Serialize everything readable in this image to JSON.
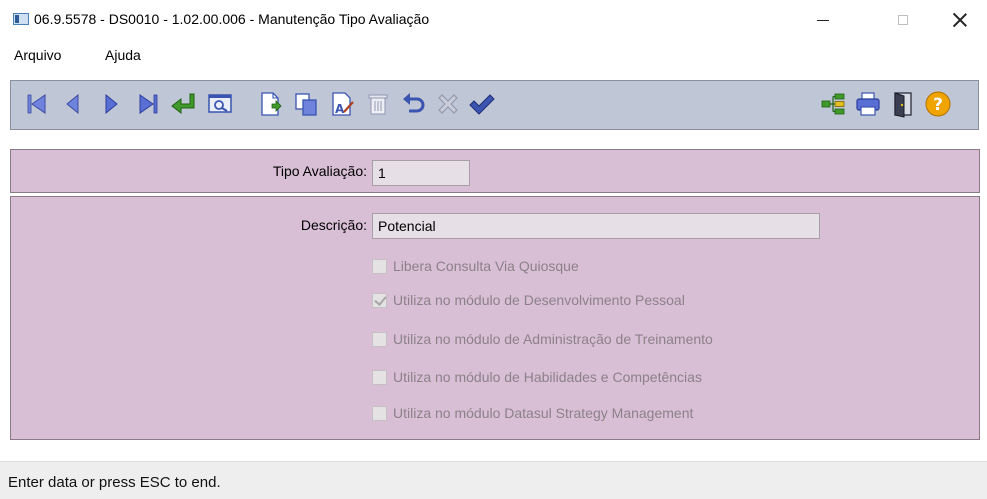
{
  "window": {
    "title": "06.9.5578 - DS0010 - 1.02.00.006 - Manutenção Tipo Avaliação"
  },
  "menu": {
    "items": [
      {
        "label": "Arquivo"
      },
      {
        "label": "Ajuda"
      }
    ]
  },
  "toolbar": {
    "colors": {
      "navigation": "#5a6fd6",
      "confirm": "#3f9a2a",
      "ok": "#3a54b0",
      "help": "#f0a400"
    },
    "buttons": [
      {
        "icon": "first-record-icon"
      },
      {
        "icon": "previous-record-icon"
      },
      {
        "icon": "next-record-icon"
      },
      {
        "icon": "last-record-icon"
      },
      {
        "icon": "goto-icon"
      },
      {
        "icon": "search-icon"
      },
      {
        "icon": "new-record-icon"
      },
      {
        "icon": "copy-record-icon"
      },
      {
        "icon": "edit-record-icon"
      },
      {
        "icon": "delete-icon"
      },
      {
        "icon": "undo-icon"
      },
      {
        "icon": "cancel-icon"
      },
      {
        "icon": "save-checkmark-icon"
      },
      {
        "icon": "tree-view-icon"
      },
      {
        "icon": "print-icon"
      },
      {
        "icon": "exit-door-icon"
      },
      {
        "icon": "help-icon",
        "label": "?"
      }
    ]
  },
  "form": {
    "tipo_avaliacao": {
      "label": "Tipo Avaliação:",
      "value": "1"
    },
    "descricao": {
      "label": "Descrição:",
      "value": "Potencial"
    },
    "checkboxes": [
      {
        "label": "Libera Consulta Via Quiosque",
        "checked": false,
        "enabled": false
      },
      {
        "label": "Utiliza no módulo de Desenvolvimento Pessoal",
        "checked": true,
        "enabled": false
      },
      {
        "label": "Utiliza no módulo de Administração de Treinamento",
        "checked": false,
        "enabled": false
      },
      {
        "label": "Utiliza no módulo de Habilidades e Competências",
        "checked": false,
        "enabled": false
      },
      {
        "label": "Utiliza no módulo Datasul Strategy Management",
        "checked": false,
        "enabled": false
      }
    ]
  },
  "status": {
    "text": "Enter data or press ESC to end."
  }
}
